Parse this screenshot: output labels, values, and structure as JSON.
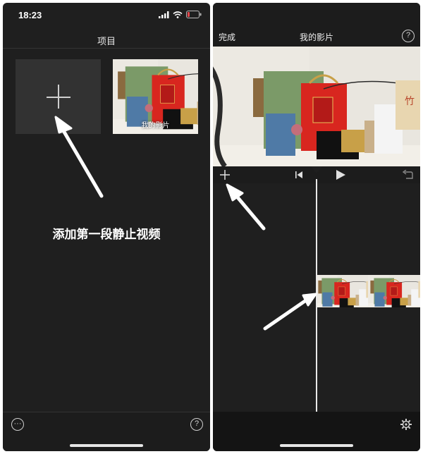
{
  "left": {
    "status": {
      "time": "18:23"
    },
    "nav_title": "项目",
    "project": {
      "label": "我的影片"
    },
    "annotation": "添加第一段静止视频",
    "bottom": {
      "more_label": "···",
      "help_label": "?"
    }
  },
  "right": {
    "top": {
      "done_label": "完成",
      "title": "我的影片",
      "help_label": "?"
    }
  },
  "colors": {
    "background": "#1f1f1f",
    "arrow": "#ffffff"
  },
  "icons": [
    "signal-icon",
    "wifi-icon",
    "battery-icon",
    "plus-icon",
    "skip-back-icon",
    "play-icon",
    "undo-icon",
    "gear-icon",
    "help-icon",
    "more-icon"
  ]
}
